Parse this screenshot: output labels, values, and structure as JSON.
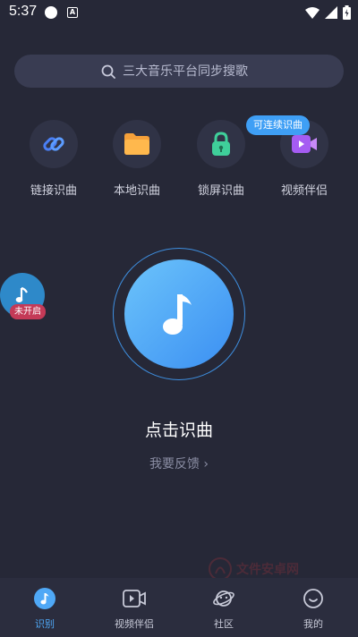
{
  "status_bar": {
    "time": "5:37",
    "notification_letter": "A"
  },
  "search": {
    "placeholder": "三大音乐平台同步搜歌"
  },
  "shortcuts": [
    {
      "label": "链接识曲",
      "icon": "link-icon",
      "color": "#4a7ff5"
    },
    {
      "label": "本地识曲",
      "icon": "folder-icon",
      "color": "#f5a03a"
    },
    {
      "label": "锁屏识曲",
      "icon": "lock-icon",
      "color": "#3fcf9a"
    },
    {
      "label": "视频伴侣",
      "icon": "video-icon",
      "color": "#a55cf2"
    }
  ],
  "continuous_badge": "可连续识曲",
  "floating_widget": {
    "status": "未开启",
    "icon": "music-note-icon"
  },
  "main": {
    "title": "点击识曲",
    "feedback": "我要反馈 ›"
  },
  "watermark": "文件安卓网",
  "bottom_nav": [
    {
      "label": "识别",
      "icon": "music-note-icon",
      "active": true
    },
    {
      "label": "视频伴侣",
      "icon": "video-icon",
      "active": false
    },
    {
      "label": "社区",
      "icon": "planet-icon",
      "active": false
    },
    {
      "label": "我的",
      "icon": "smile-icon",
      "active": false
    }
  ],
  "colors": {
    "background": "#262837",
    "accent": "#4fa8f6",
    "badge_red": "#c43a57"
  }
}
